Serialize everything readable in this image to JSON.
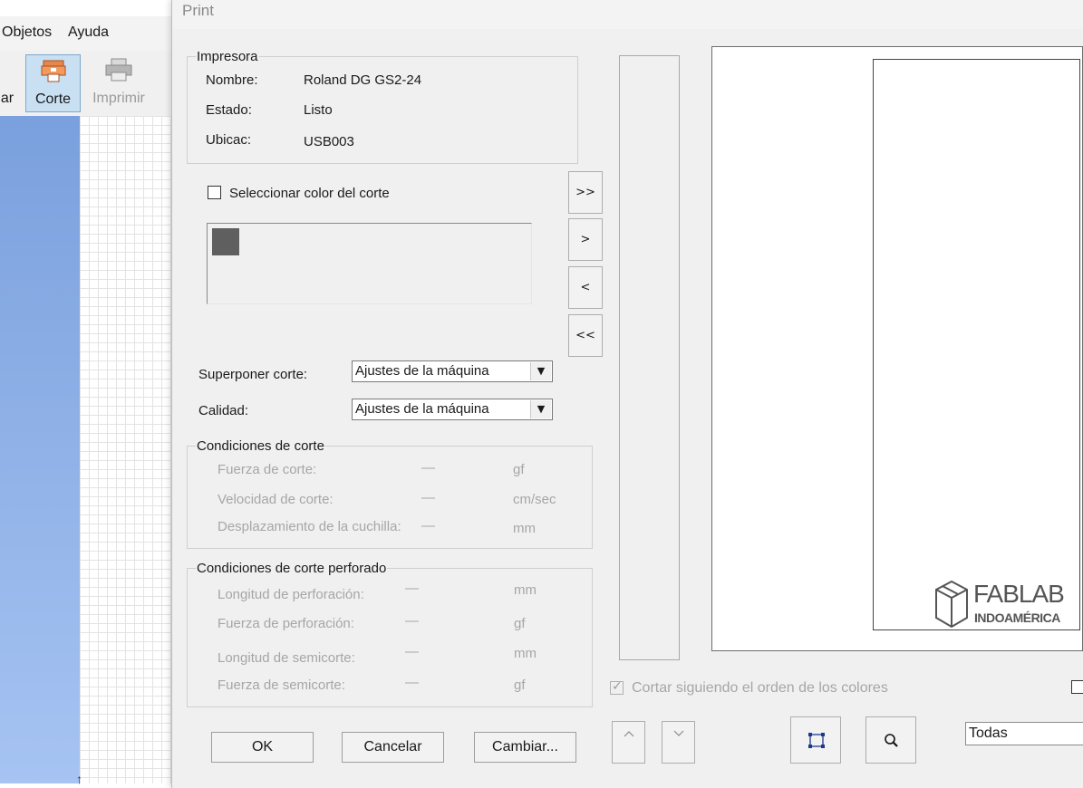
{
  "app": {
    "menu": {
      "objetos": "Objetos",
      "ayuda": "Ayuda"
    },
    "toolbar": {
      "partial_label": "ar",
      "corte": "Corte",
      "imprimir": "Imprimir"
    }
  },
  "dialog": {
    "title": "Print",
    "impresora": {
      "legend": "Impresora",
      "nombre_label": "Nombre:",
      "nombre_value": "Roland DG GS2-24",
      "estado_label": "Estado:",
      "estado_value": "Listo",
      "ubicac_label": "Ubicac:",
      "ubicac_value": "USB003"
    },
    "seleccionar_color_label": "Seleccionar color del corte",
    "move_buttons": [
      ">>",
      ">",
      "<",
      "<<"
    ],
    "superponer_label": "Superponer corte:",
    "superponer_value": "Ajustes de la máquina",
    "calidad_label": "Calidad:",
    "calidad_value": "Ajustes de la máquina",
    "condiciones": {
      "legend": "Condiciones de corte",
      "rows": [
        {
          "label": "Fuerza de corte:",
          "value": "—",
          "unit": "gf"
        },
        {
          "label": "Velocidad de corte:",
          "value": "—",
          "unit": "cm/sec"
        },
        {
          "label": "Desplazamiento de la cuchilla:",
          "value": "—",
          "unit": "mm"
        }
      ]
    },
    "perforado": {
      "legend": "Condiciones de corte perforado",
      "rows": [
        {
          "label": "Longitud de perforación:",
          "value": "—",
          "unit": "mm"
        },
        {
          "label": "Fuerza de perforación:",
          "value": "—",
          "unit": "gf"
        },
        {
          "label": "Longitud de semicorte:",
          "value": "—",
          "unit": "mm"
        },
        {
          "label": "Fuerza de semicorte:",
          "value": "—",
          "unit": "gf"
        }
      ]
    },
    "cortar_orden_label": "Cortar siguiendo el orden de los colores",
    "buttons": {
      "ok": "OK",
      "cancelar": "Cancelar",
      "cambiar": "Cambiar..."
    },
    "page_select_value": "Todas",
    "logo": {
      "line1": "FABLAB",
      "line2": "INDOAMÉRICA"
    }
  }
}
